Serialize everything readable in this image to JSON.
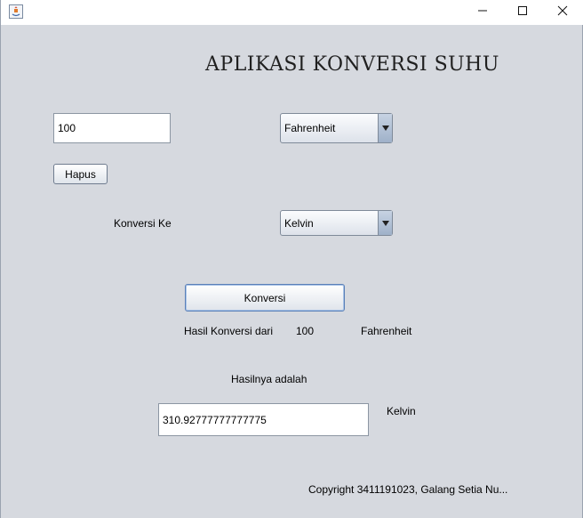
{
  "window": {
    "icons": {
      "app": "java-app-icon",
      "minimize": "minimize-icon",
      "maximize": "maximize-icon",
      "close": "close-icon"
    }
  },
  "app": {
    "title": "APLIKASI KONVERSI SUHU",
    "input_value": "100",
    "from_unit": "Fahrenheit",
    "clear_label": "Hapus",
    "convert_to_label": "Konversi Ke",
    "to_unit": "Kelvin",
    "convert_button": "Konversi",
    "result_from_label": "Hasil Konversi dari",
    "result_from_value": "100",
    "result_from_unit": "Fahrenheit",
    "result_label": "Hasilnya adalah",
    "result_value": "310.92777777777775",
    "result_unit": "Kelvin",
    "copyright": "Copyright 3411191023, Galang Setia Nu..."
  }
}
